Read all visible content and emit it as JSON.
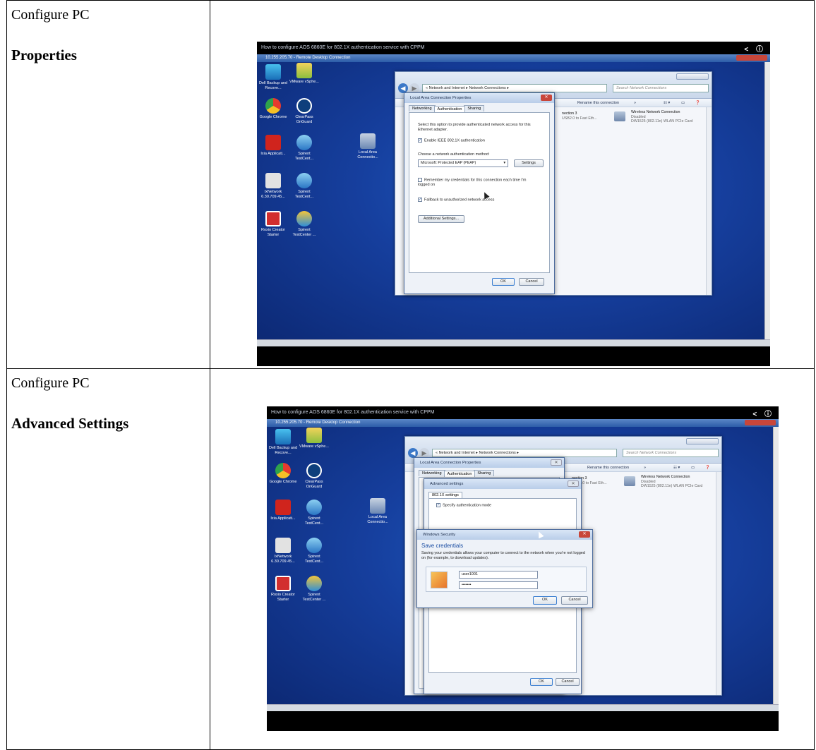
{
  "rows": [
    {
      "label": "Configure PC",
      "heading": "Properties",
      "screenshot": {
        "video_title": "How to configure AOS 6860E for 802.1X authentication service with CPPM",
        "rdp_title": "10.255.205.70 - Remote Desktop Connection",
        "desktop_icons": [
          {
            "icon": "dell-backup-icon",
            "label": "Dell Backup and Recove..."
          },
          {
            "icon": "vmware-icon",
            "label": "VMware vSphe..."
          },
          {
            "icon": "chrome-icon",
            "label": "Google Chrome"
          },
          {
            "icon": "clearpass-icon",
            "label": "ClearPass OnGuard"
          },
          {
            "icon": "ixia-icon",
            "label": "Ixia Applicati..."
          },
          {
            "icon": "spirent-icon",
            "label": "Spirent TestCent..."
          },
          {
            "icon": "ixnetwork-icon",
            "label": "IxNetwork 6.30.709.45..."
          },
          {
            "icon": "spirent-icon",
            "label": "Spirent TestCent..."
          },
          {
            "icon": "roxio-icon",
            "label": "Roxio Creator Starter"
          },
          {
            "icon": "spirent-testcenter-icon",
            "label": "Spirent TestCenter ..."
          },
          {
            "icon": "network-icon",
            "label": "Local Area Connectio..."
          }
        ],
        "explorer": {
          "address": "« Network and Internet ▸ Network Connections ▸",
          "search_placeholder": "Search Network Connections",
          "rename": "Rename this connection",
          "more": "»",
          "conn3_name": "nection 3",
          "conn3_desc": "USB2.0 to Fast Eth...",
          "wifi_name": "Wireless Network Connection",
          "wifi_status": "Disabled",
          "wifi_desc": "DW1525 (802.11n) WLAN PCIe Card"
        },
        "dialog": {
          "title": "Local Area Connection Properties",
          "tabs": [
            "Networking",
            "Authentication",
            "Sharing"
          ],
          "intro": "Select this option to provide authenticated network access for this Ethernet adapter.",
          "enable_8021x": "Enable IEEE 802.1X authentication",
          "method_label": "Choose a network authentication method:",
          "method_value": "Microsoft: Protected EAP (PEAP)",
          "settings_btn": "Settings",
          "remember": "Remember my credentials for this connection each time I'm logged on",
          "fallback": "Fallback to unauthorized network access",
          "additional_btn": "Additional Settings...",
          "ok": "OK",
          "cancel": "Cancel"
        }
      }
    },
    {
      "label": "Configure PC",
      "heading": "Advanced Settings",
      "screenshot": {
        "video_title": "How to configure AOS 6860E for 802.1X authentication service with CPPM",
        "rdp_title": "10.255.205.70 - Remote Desktop Connection",
        "explorer": {
          "address": "« Network and Internet ▸ Network Connections ▸",
          "search_placeholder": "Search Network Connections",
          "rename": "Rename this connection",
          "more": "»",
          "conn3_name": "nection 3",
          "conn3_desc": "USB2.0 to Fast Eth...",
          "wifi_name": "Wireless Network Connection",
          "wifi_status": "Disabled",
          "wifi_desc": "DW1525 (802.11n) WLAN PCIe Card"
        },
        "props_title": "Local Area Connection Properties",
        "tabs": [
          "Networking",
          "Authentication",
          "Sharing"
        ],
        "advanced": {
          "title": "Advanced settings",
          "tab": "802.1X settings",
          "specify": "Specify authentication mode"
        },
        "winsec": {
          "title": "Windows Security",
          "heading": "Save credentials",
          "desc": "Saving your credentials allows your computer to connect to the network when you're not logged on (for example, to download updates).",
          "username": "user1001",
          "password": "•••••••",
          "ok": "OK",
          "cancel": "Cancel"
        },
        "ok": "OK",
        "cancel": "Cancel"
      }
    }
  ]
}
